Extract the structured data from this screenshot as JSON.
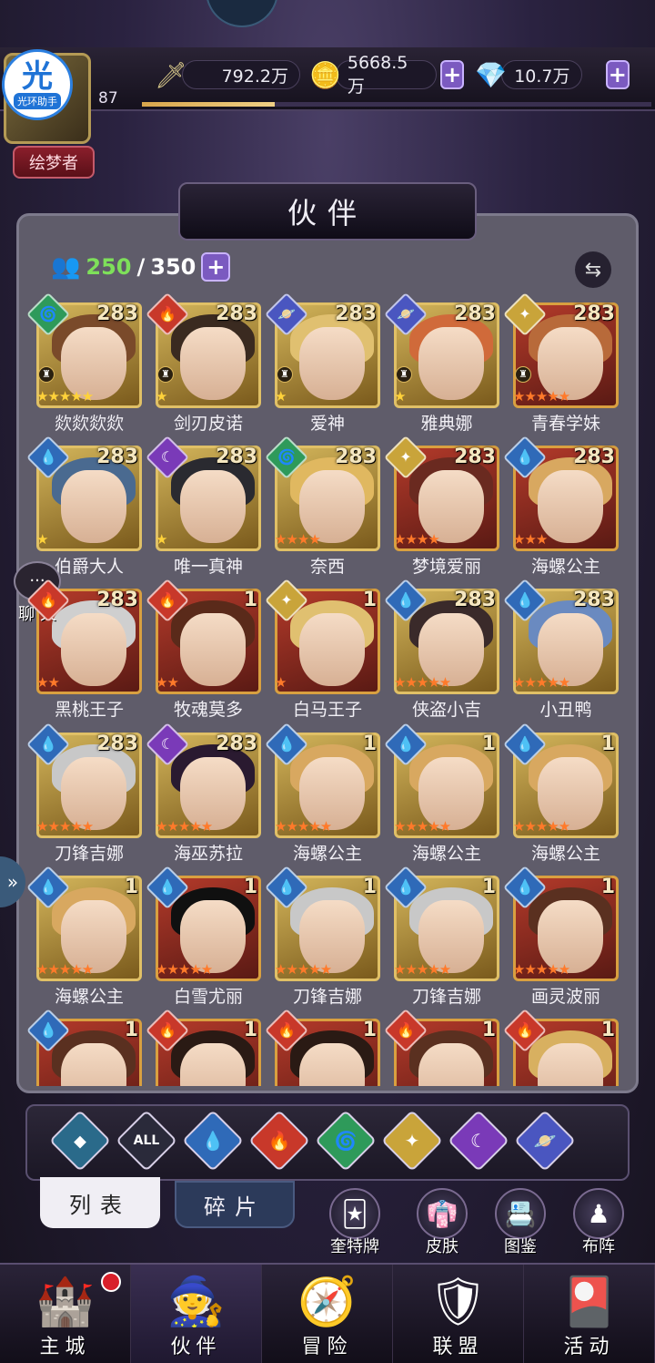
{
  "header": {
    "logo_char": "光",
    "logo_text": "光环助手",
    "level": "87",
    "title_badge": "绘梦者",
    "exp_percent": 0.26,
    "power": "792.2万",
    "gold": "5668.5万",
    "diamonds": "10.7万",
    "plus": "+"
  },
  "panel": {
    "title": "伙伴",
    "capacity_current": "250",
    "capacity_sep": "/",
    "capacity_max": "350"
  },
  "cards": [
    {
      "name": "欻欻欻欻",
      "level": "283",
      "elem": "wind",
      "stars": 5,
      "star_color": "gold",
      "frame": "gold",
      "hair": "#7a4a2a",
      "rank": true
    },
    {
      "name": "剑刃皮诺",
      "level": "283",
      "elem": "fire",
      "stars": 1,
      "star_color": "gold",
      "frame": "gold",
      "hair": "#3a2a20",
      "rank": true
    },
    {
      "name": "爱神",
      "level": "283",
      "elem": "void",
      "stars": 1,
      "star_color": "gold",
      "frame": "gold",
      "hair": "#e0c070",
      "rank": true
    },
    {
      "name": "雅典娜",
      "level": "283",
      "elem": "void",
      "stars": 1,
      "star_color": "gold",
      "frame": "gold",
      "hair": "#d06a3a",
      "rank": true
    },
    {
      "name": "青春学妹",
      "level": "283",
      "elem": "light",
      "stars": 5,
      "star_color": "red",
      "frame": "red",
      "hair": "#b86a3a",
      "rank": true
    },
    {
      "name": "伯爵大人",
      "level": "283",
      "elem": "water",
      "stars": 1,
      "star_color": "gold",
      "frame": "gold",
      "hair": "#4a6a90",
      "rank": false
    },
    {
      "name": "唯一真神",
      "level": "283",
      "elem": "dark",
      "stars": 1,
      "star_color": "gold",
      "frame": "gold",
      "hair": "#2a2a30",
      "rank": false
    },
    {
      "name": "奈西",
      "level": "283",
      "elem": "wind",
      "stars": 4,
      "star_color": "red",
      "frame": "gold",
      "hair": "#e0b860",
      "rank": false
    },
    {
      "name": "梦境爱丽",
      "level": "283",
      "elem": "light",
      "stars": 4,
      "star_color": "red",
      "frame": "red",
      "hair": "#6a2a20",
      "rank": false
    },
    {
      "name": "海螺公主",
      "level": "283",
      "elem": "water",
      "stars": 3,
      "star_color": "red",
      "frame": "red",
      "hair": "#d8a860",
      "rank": false
    },
    {
      "name": "黑桃王子",
      "level": "283",
      "elem": "fire",
      "stars": 2,
      "star_color": "red",
      "frame": "red",
      "hair": "#cfcfcf",
      "rank": false
    },
    {
      "name": "牧魂莫多",
      "level": "1",
      "elem": "fire",
      "stars": 2,
      "star_color": "red",
      "frame": "red",
      "hair": "#5a2a1a",
      "rank": false
    },
    {
      "name": "白马王子",
      "level": "1",
      "elem": "light",
      "stars": 1,
      "star_color": "red",
      "frame": "red",
      "hair": "#e0c070",
      "rank": false
    },
    {
      "name": "侠盗小吉",
      "level": "283",
      "elem": "water",
      "stars": 5,
      "star_color": "red",
      "frame": "gold",
      "hair": "#3a2a2a",
      "rank": false
    },
    {
      "name": "小丑鸭",
      "level": "283",
      "elem": "water",
      "stars": 5,
      "star_color": "red",
      "frame": "gold",
      "hair": "#6a8ac0",
      "rank": false
    },
    {
      "name": "刀锋吉娜",
      "level": "283",
      "elem": "water",
      "stars": 5,
      "star_color": "red",
      "frame": "gold",
      "hair": "#c8c8c8",
      "rank": false
    },
    {
      "name": "海巫苏拉",
      "level": "283",
      "elem": "dark",
      "stars": 5,
      "star_color": "red",
      "frame": "gold",
      "hair": "#2a1a30",
      "rank": false
    },
    {
      "name": "海螺公主",
      "level": "1",
      "elem": "water",
      "stars": 5,
      "star_color": "red",
      "frame": "gold",
      "hair": "#d8a860",
      "rank": false
    },
    {
      "name": "海螺公主",
      "level": "1",
      "elem": "water",
      "stars": 5,
      "star_color": "red",
      "frame": "gold",
      "hair": "#d8a860",
      "rank": false
    },
    {
      "name": "海螺公主",
      "level": "1",
      "elem": "water",
      "stars": 5,
      "star_color": "red",
      "frame": "gold",
      "hair": "#d8a860",
      "rank": false
    },
    {
      "name": "海螺公主",
      "level": "1",
      "elem": "water",
      "stars": 5,
      "star_color": "red",
      "frame": "gold",
      "hair": "#d8a860",
      "rank": false
    },
    {
      "name": "白雪尤丽",
      "level": "1",
      "elem": "water",
      "stars": 5,
      "star_color": "red",
      "frame": "red",
      "hair": "#101010",
      "rank": false
    },
    {
      "name": "刀锋吉娜",
      "level": "1",
      "elem": "water",
      "stars": 5,
      "star_color": "red",
      "frame": "gold",
      "hair": "#c8c8c8",
      "rank": false
    },
    {
      "name": "刀锋吉娜",
      "level": "1",
      "elem": "water",
      "stars": 5,
      "star_color": "red",
      "frame": "gold",
      "hair": "#c8c8c8",
      "rank": false
    },
    {
      "name": "画灵波丽",
      "level": "1",
      "elem": "water",
      "stars": 5,
      "star_color": "red",
      "frame": "red",
      "hair": "#5a3020",
      "rank": false
    },
    {
      "name": "",
      "level": "1",
      "elem": "water",
      "stars": 0,
      "star_color": "red",
      "frame": "red",
      "hair": "#5a3020",
      "rank": false
    },
    {
      "name": "",
      "level": "1",
      "elem": "fire",
      "stars": 0,
      "star_color": "red",
      "frame": "red",
      "hair": "#2a1a14",
      "rank": false
    },
    {
      "name": "",
      "level": "1",
      "elem": "fire",
      "stars": 0,
      "star_color": "red",
      "frame": "red",
      "hair": "#2a1a14",
      "rank": false
    },
    {
      "name": "",
      "level": "1",
      "elem": "fire",
      "stars": 0,
      "star_color": "red",
      "frame": "red",
      "hair": "#5a3020",
      "rank": false
    },
    {
      "name": "",
      "level": "1",
      "elem": "fire",
      "stars": 0,
      "star_color": "red",
      "frame": "red",
      "hair": "#d8b060",
      "rank": false
    }
  ],
  "element_colors": {
    "wind": "#2e9a5a",
    "fire": "#c8382a",
    "void": "#4a56c0",
    "light": "#c9a43a",
    "water": "#2f6ab8",
    "dark": "#7a3ab8",
    "all": "#2a2a3a",
    "default": "#2a6a8a"
  },
  "element_glyphs": {
    "wind": "🌀",
    "fire": "🔥",
    "void": "🪐",
    "light": "✦",
    "water": "💧",
    "dark": "☾",
    "all": "ALL",
    "default": "⬥"
  },
  "filters": [
    "default",
    "all",
    "water",
    "fire",
    "wind",
    "light",
    "dark",
    "void"
  ],
  "tabs": {
    "list": "列表",
    "fragments": "碎片"
  },
  "sub_buttons": [
    {
      "label": "奎特牌",
      "icon": "card-icon",
      "glyph": "🃏"
    },
    {
      "label": "皮肤",
      "icon": "outfit-icon",
      "glyph": "👘"
    },
    {
      "label": "图鉴",
      "icon": "codex-icon",
      "glyph": "📇"
    },
    {
      "label": "布阵",
      "icon": "formation-icon",
      "glyph": "♟"
    }
  ],
  "chat": {
    "label": "聊 天",
    "glyph": "···"
  },
  "side_arrow": "»",
  "swap_glyph": "⇆",
  "bottom_nav": [
    {
      "label": "主城",
      "icon": "castle-icon",
      "glyph": "🏰",
      "active": false,
      "badge": true
    },
    {
      "label": "伙伴",
      "icon": "witch-hat-icon",
      "glyph": "🧙",
      "active": true,
      "badge": false
    },
    {
      "label": "冒险",
      "icon": "compass-icon",
      "glyph": "🧭",
      "active": false,
      "badge": false
    },
    {
      "label": "联盟",
      "icon": "shield-icon",
      "glyph": "🛡",
      "active": false,
      "badge": false
    },
    {
      "label": "活动",
      "icon": "cards-icon",
      "glyph": "🎴",
      "active": false,
      "badge": false
    }
  ]
}
